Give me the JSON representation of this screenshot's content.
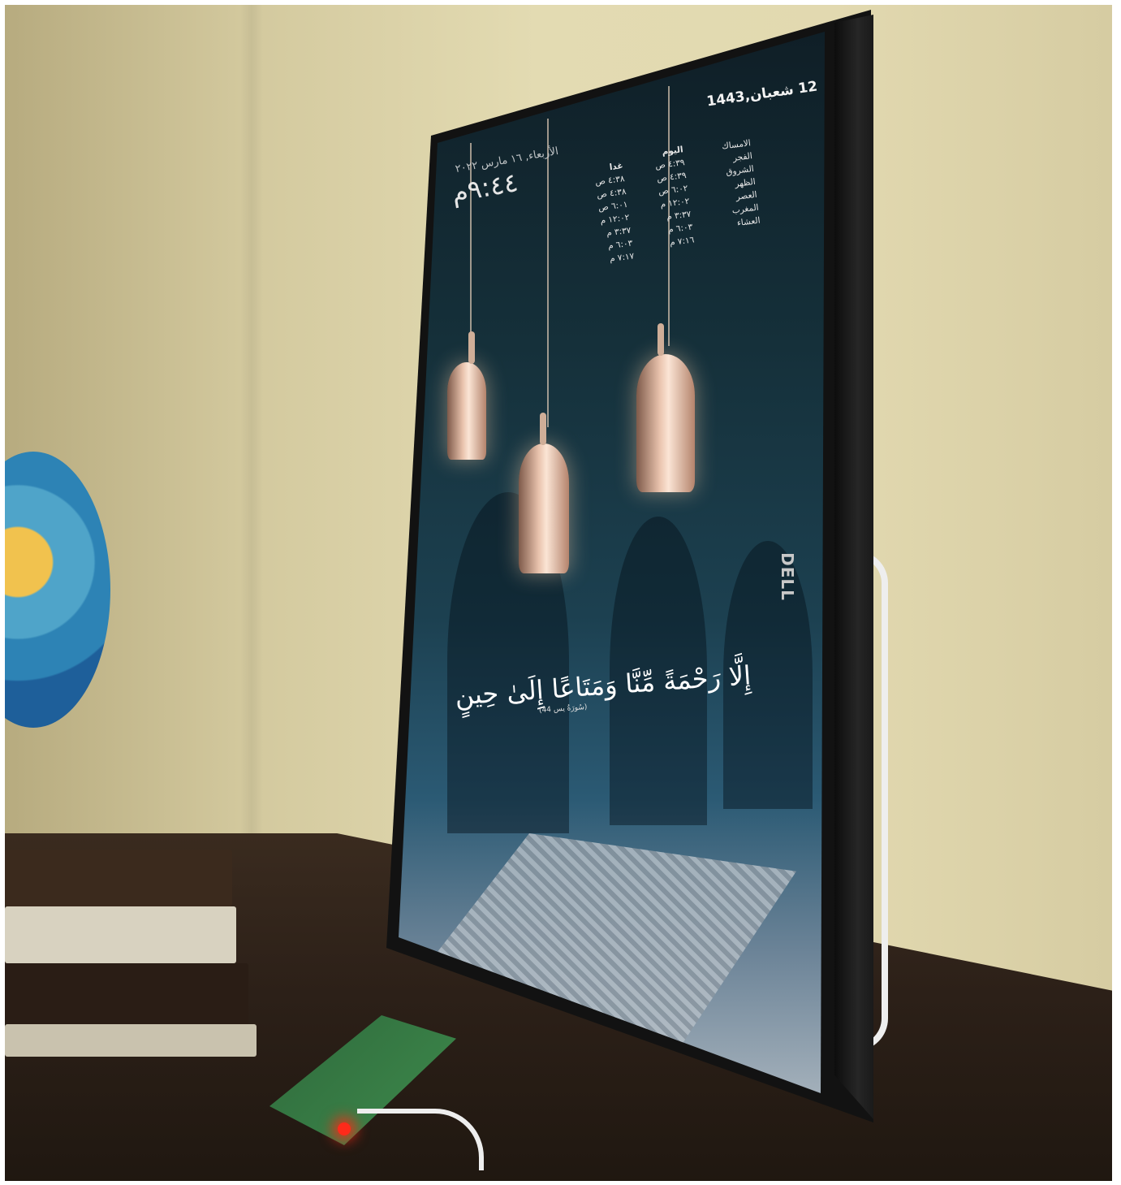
{
  "screen": {
    "hijri_date": "12 شعبان,1443",
    "gregorian_date": "الأربعاء, ١٦ مارس ٢٠٢٢",
    "clock": "٩:٤٤م",
    "prayer_labels": {
      "header": "",
      "items": [
        "الامساك",
        "الفجر",
        "الشروق",
        "الظهر",
        "العصر",
        "المغرب",
        "العشاء"
      ]
    },
    "today": {
      "header": "اليوم",
      "items": [
        "٤:٣٩ ص",
        "٤:٣٩ ص",
        "٦:٠٢ ص",
        "١٢:٠٢ م",
        "٣:٣٧ م",
        "٦:٠٣ م",
        "٧:١٦ م"
      ]
    },
    "tomorrow": {
      "header": "غدا",
      "items": [
        "٤:٣٨ ص",
        "٤:٣٨ ص",
        "٦:٠١ ص",
        "١٢:٠٢ م",
        "٣:٣٧ م",
        "٦:٠٣ م",
        "٧:١٧ م"
      ]
    },
    "ayah": "إِلَّا رَحْمَةً مِّنَّا وَمَتَاعًا إِلَىٰ حِينٍ",
    "ayah_reference": "(سُورَةُ يس 44)"
  },
  "monitor_brand": "DELL",
  "colors": {
    "wall": "#e2d9b0",
    "desk": "#2c2018",
    "bezel": "#121212",
    "screen_top": "#0f1e26",
    "led": "#ff2a1a"
  }
}
